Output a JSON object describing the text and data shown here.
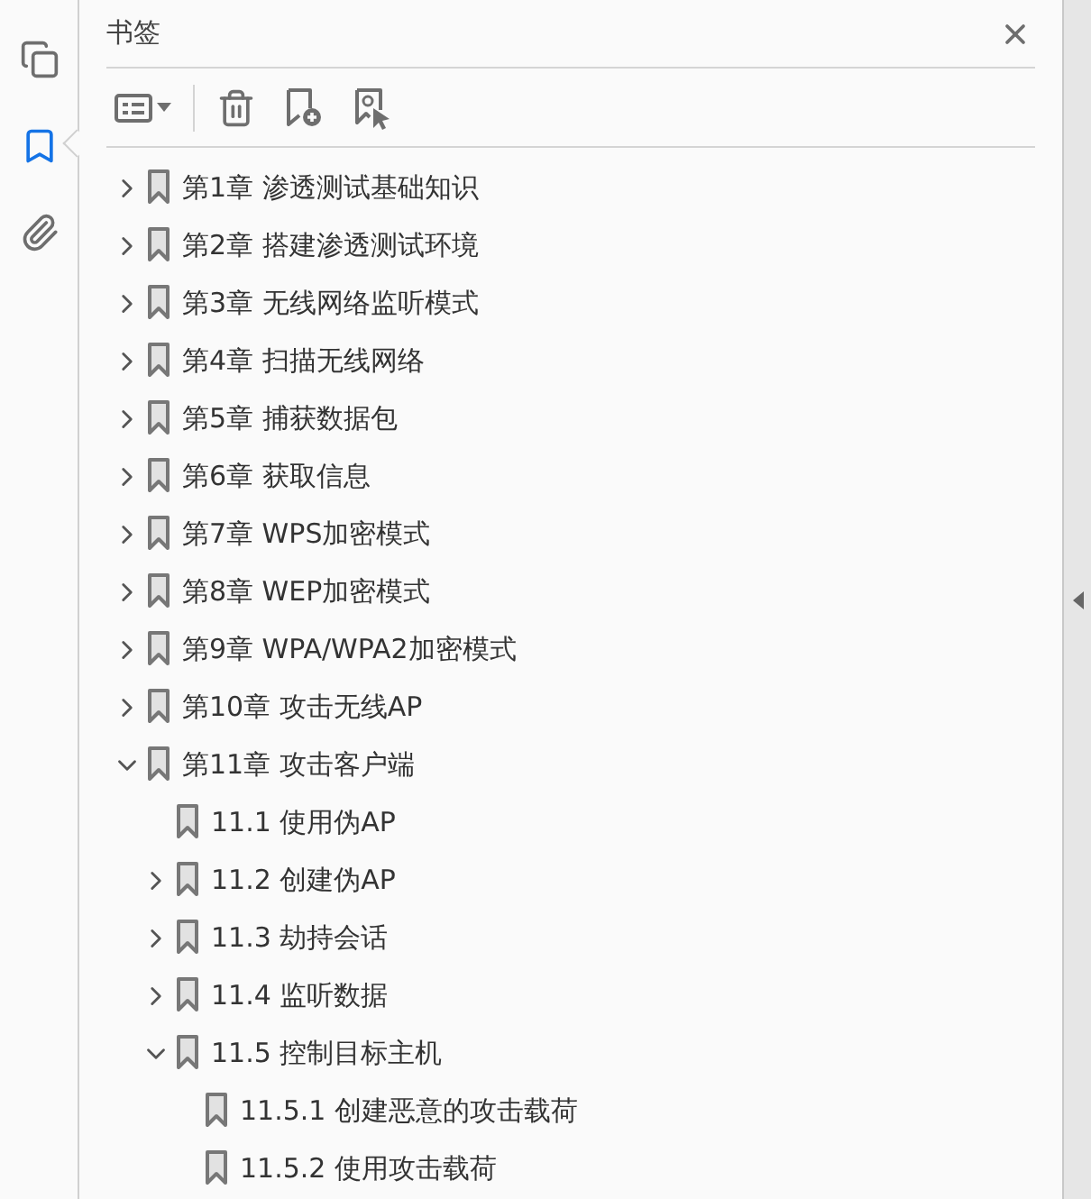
{
  "rail": [
    {
      "kind": "pages",
      "selected": false
    },
    {
      "kind": "bookmarks",
      "selected": true
    },
    {
      "kind": "attachments",
      "selected": false
    }
  ],
  "panel": {
    "title": "书签"
  },
  "bookmarks": [
    {
      "label": "第1章 渗透测试基础知识",
      "kind": "branch",
      "expanded": false
    },
    {
      "label": "第2章 搭建渗透测试环境",
      "kind": "branch",
      "expanded": false
    },
    {
      "label": "第3章 无线网络监听模式",
      "kind": "branch",
      "expanded": false
    },
    {
      "label": "第4章 扫描无线网络",
      "kind": "branch",
      "expanded": false
    },
    {
      "label": "第5章 捕获数据包",
      "kind": "branch",
      "expanded": false
    },
    {
      "label": "第6章 获取信息",
      "kind": "branch",
      "expanded": false
    },
    {
      "label": "第7章 WPS加密模式",
      "kind": "branch",
      "expanded": false
    },
    {
      "label": "第8章 WEP加密模式",
      "kind": "branch",
      "expanded": false
    },
    {
      "label": "第9章 WPA/WPA2加密模式",
      "kind": "branch",
      "expanded": false
    },
    {
      "label": "第10章 攻击无线AP",
      "kind": "branch",
      "expanded": false
    },
    {
      "label": "第11章 攻击客户端",
      "kind": "branch",
      "expanded": true,
      "children": [
        {
          "label": "11.1 使用伪AP",
          "kind": "leaf"
        },
        {
          "label": "11.2 创建伪AP",
          "kind": "branch",
          "expanded": false
        },
        {
          "label": "11.3 劫持会话",
          "kind": "branch",
          "expanded": false
        },
        {
          "label": "11.4 监听数据",
          "kind": "branch",
          "expanded": false
        },
        {
          "label": "11.5 控制目标主机",
          "kind": "branch",
          "expanded": true,
          "children": [
            {
              "label": "11.5.1 创建恶意的攻击载荷",
              "kind": "leaf"
            },
            {
              "label": "11.5.2 使用攻击载荷",
              "kind": "leaf"
            }
          ]
        }
      ]
    }
  ]
}
